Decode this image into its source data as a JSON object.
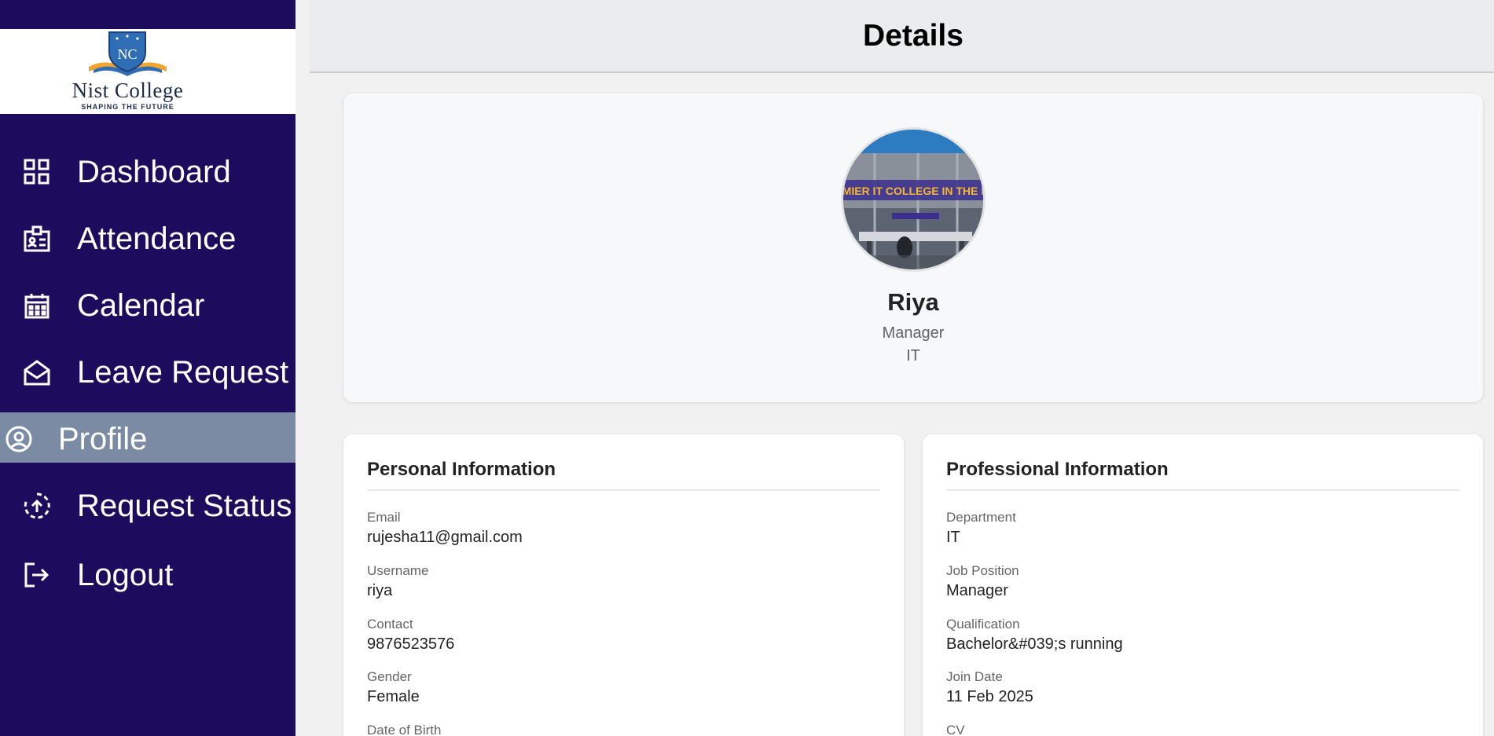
{
  "sidebar": {
    "logo": {
      "name": "Nist College",
      "tagline": "SHAPING THE FUTURE",
      "monogram": "NC"
    },
    "items": [
      {
        "label": "Dashboard",
        "icon": "dashboard-grid-icon"
      },
      {
        "label": "Attendance",
        "icon": "id-badge-icon"
      },
      {
        "label": "Calendar",
        "icon": "calendar-icon"
      },
      {
        "label": "Leave Request",
        "icon": "mail-open-icon"
      },
      {
        "label": "Profile",
        "icon": "user-circle-icon",
        "active": true
      },
      {
        "label": "Request Status",
        "icon": "upload-circle-icon"
      },
      {
        "label": "Logout",
        "icon": "logout-icon"
      }
    ]
  },
  "header": {
    "title": "Details"
  },
  "profile": {
    "avatar_banner_text": "MIER IT COLLEGE IN THE R",
    "name": "Riya",
    "role": "Manager",
    "department": "IT"
  },
  "personal": {
    "title": "Personal Information",
    "fields": [
      {
        "label": "Email",
        "value": "rujesha11@gmail.com"
      },
      {
        "label": "Username",
        "value": "riya"
      },
      {
        "label": "Contact",
        "value": "9876523576"
      },
      {
        "label": "Gender",
        "value": "Female"
      },
      {
        "label": "Date of Birth",
        "value": ""
      }
    ]
  },
  "professional": {
    "title": "Professional Information",
    "fields": [
      {
        "label": "Department",
        "value": "IT"
      },
      {
        "label": "Job Position",
        "value": "Manager"
      },
      {
        "label": "Qualification",
        "value": "Bachelor&#039;s running"
      },
      {
        "label": "Join Date",
        "value": "11 Feb 2025"
      },
      {
        "label": "CV",
        "value": ""
      }
    ]
  },
  "colors": {
    "sidebar_bg": "#1d0b5d",
    "active_item_bg": "#7a8ba3",
    "header_bg": "#eaeced",
    "page_bg": "#f1f1f2"
  }
}
